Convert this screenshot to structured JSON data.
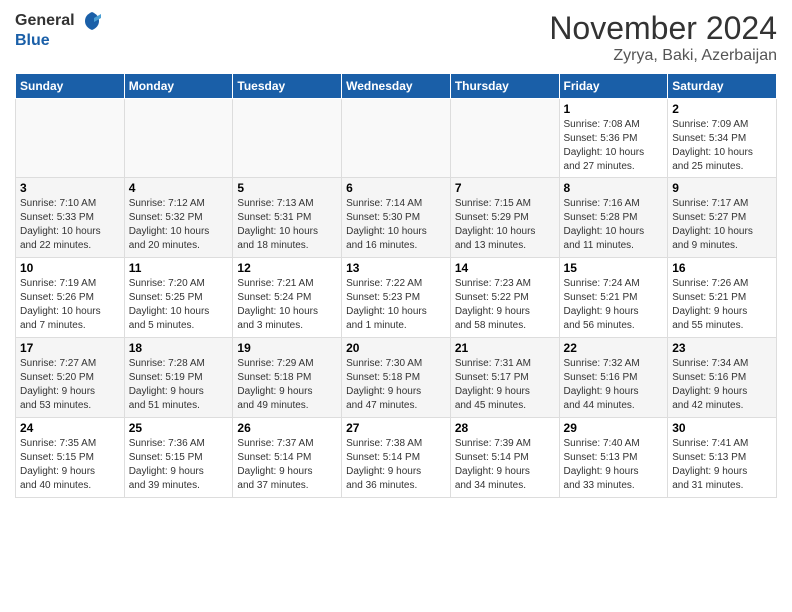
{
  "header": {
    "logo_line1": "General",
    "logo_line2": "Blue",
    "month_title": "November 2024",
    "location": "Zyrya, Baki, Azerbaijan"
  },
  "day_headers": [
    "Sunday",
    "Monday",
    "Tuesday",
    "Wednesday",
    "Thursday",
    "Friday",
    "Saturday"
  ],
  "weeks": [
    {
      "days": [
        {
          "num": "",
          "info": "",
          "empty": true
        },
        {
          "num": "",
          "info": "",
          "empty": true
        },
        {
          "num": "",
          "info": "",
          "empty": true
        },
        {
          "num": "",
          "info": "",
          "empty": true
        },
        {
          "num": "",
          "info": "",
          "empty": true
        },
        {
          "num": "1",
          "info": "Sunrise: 7:08 AM\nSunset: 5:36 PM\nDaylight: 10 hours\nand 27 minutes.",
          "empty": false
        },
        {
          "num": "2",
          "info": "Sunrise: 7:09 AM\nSunset: 5:34 PM\nDaylight: 10 hours\nand 25 minutes.",
          "empty": false
        }
      ]
    },
    {
      "days": [
        {
          "num": "3",
          "info": "Sunrise: 7:10 AM\nSunset: 5:33 PM\nDaylight: 10 hours\nand 22 minutes.",
          "empty": false
        },
        {
          "num": "4",
          "info": "Sunrise: 7:12 AM\nSunset: 5:32 PM\nDaylight: 10 hours\nand 20 minutes.",
          "empty": false
        },
        {
          "num": "5",
          "info": "Sunrise: 7:13 AM\nSunset: 5:31 PM\nDaylight: 10 hours\nand 18 minutes.",
          "empty": false
        },
        {
          "num": "6",
          "info": "Sunrise: 7:14 AM\nSunset: 5:30 PM\nDaylight: 10 hours\nand 16 minutes.",
          "empty": false
        },
        {
          "num": "7",
          "info": "Sunrise: 7:15 AM\nSunset: 5:29 PM\nDaylight: 10 hours\nand 13 minutes.",
          "empty": false
        },
        {
          "num": "8",
          "info": "Sunrise: 7:16 AM\nSunset: 5:28 PM\nDaylight: 10 hours\nand 11 minutes.",
          "empty": false
        },
        {
          "num": "9",
          "info": "Sunrise: 7:17 AM\nSunset: 5:27 PM\nDaylight: 10 hours\nand 9 minutes.",
          "empty": false
        }
      ]
    },
    {
      "days": [
        {
          "num": "10",
          "info": "Sunrise: 7:19 AM\nSunset: 5:26 PM\nDaylight: 10 hours\nand 7 minutes.",
          "empty": false
        },
        {
          "num": "11",
          "info": "Sunrise: 7:20 AM\nSunset: 5:25 PM\nDaylight: 10 hours\nand 5 minutes.",
          "empty": false
        },
        {
          "num": "12",
          "info": "Sunrise: 7:21 AM\nSunset: 5:24 PM\nDaylight: 10 hours\nand 3 minutes.",
          "empty": false
        },
        {
          "num": "13",
          "info": "Sunrise: 7:22 AM\nSunset: 5:23 PM\nDaylight: 10 hours\nand 1 minute.",
          "empty": false
        },
        {
          "num": "14",
          "info": "Sunrise: 7:23 AM\nSunset: 5:22 PM\nDaylight: 9 hours\nand 58 minutes.",
          "empty": false
        },
        {
          "num": "15",
          "info": "Sunrise: 7:24 AM\nSunset: 5:21 PM\nDaylight: 9 hours\nand 56 minutes.",
          "empty": false
        },
        {
          "num": "16",
          "info": "Sunrise: 7:26 AM\nSunset: 5:21 PM\nDaylight: 9 hours\nand 55 minutes.",
          "empty": false
        }
      ]
    },
    {
      "days": [
        {
          "num": "17",
          "info": "Sunrise: 7:27 AM\nSunset: 5:20 PM\nDaylight: 9 hours\nand 53 minutes.",
          "empty": false
        },
        {
          "num": "18",
          "info": "Sunrise: 7:28 AM\nSunset: 5:19 PM\nDaylight: 9 hours\nand 51 minutes.",
          "empty": false
        },
        {
          "num": "19",
          "info": "Sunrise: 7:29 AM\nSunset: 5:18 PM\nDaylight: 9 hours\nand 49 minutes.",
          "empty": false
        },
        {
          "num": "20",
          "info": "Sunrise: 7:30 AM\nSunset: 5:18 PM\nDaylight: 9 hours\nand 47 minutes.",
          "empty": false
        },
        {
          "num": "21",
          "info": "Sunrise: 7:31 AM\nSunset: 5:17 PM\nDaylight: 9 hours\nand 45 minutes.",
          "empty": false
        },
        {
          "num": "22",
          "info": "Sunrise: 7:32 AM\nSunset: 5:16 PM\nDaylight: 9 hours\nand 44 minutes.",
          "empty": false
        },
        {
          "num": "23",
          "info": "Sunrise: 7:34 AM\nSunset: 5:16 PM\nDaylight: 9 hours\nand 42 minutes.",
          "empty": false
        }
      ]
    },
    {
      "days": [
        {
          "num": "24",
          "info": "Sunrise: 7:35 AM\nSunset: 5:15 PM\nDaylight: 9 hours\nand 40 minutes.",
          "empty": false
        },
        {
          "num": "25",
          "info": "Sunrise: 7:36 AM\nSunset: 5:15 PM\nDaylight: 9 hours\nand 39 minutes.",
          "empty": false
        },
        {
          "num": "26",
          "info": "Sunrise: 7:37 AM\nSunset: 5:14 PM\nDaylight: 9 hours\nand 37 minutes.",
          "empty": false
        },
        {
          "num": "27",
          "info": "Sunrise: 7:38 AM\nSunset: 5:14 PM\nDaylight: 9 hours\nand 36 minutes.",
          "empty": false
        },
        {
          "num": "28",
          "info": "Sunrise: 7:39 AM\nSunset: 5:14 PM\nDaylight: 9 hours\nand 34 minutes.",
          "empty": false
        },
        {
          "num": "29",
          "info": "Sunrise: 7:40 AM\nSunset: 5:13 PM\nDaylight: 9 hours\nand 33 minutes.",
          "empty": false
        },
        {
          "num": "30",
          "info": "Sunrise: 7:41 AM\nSunset: 5:13 PM\nDaylight: 9 hours\nand 31 minutes.",
          "empty": false
        }
      ]
    }
  ]
}
